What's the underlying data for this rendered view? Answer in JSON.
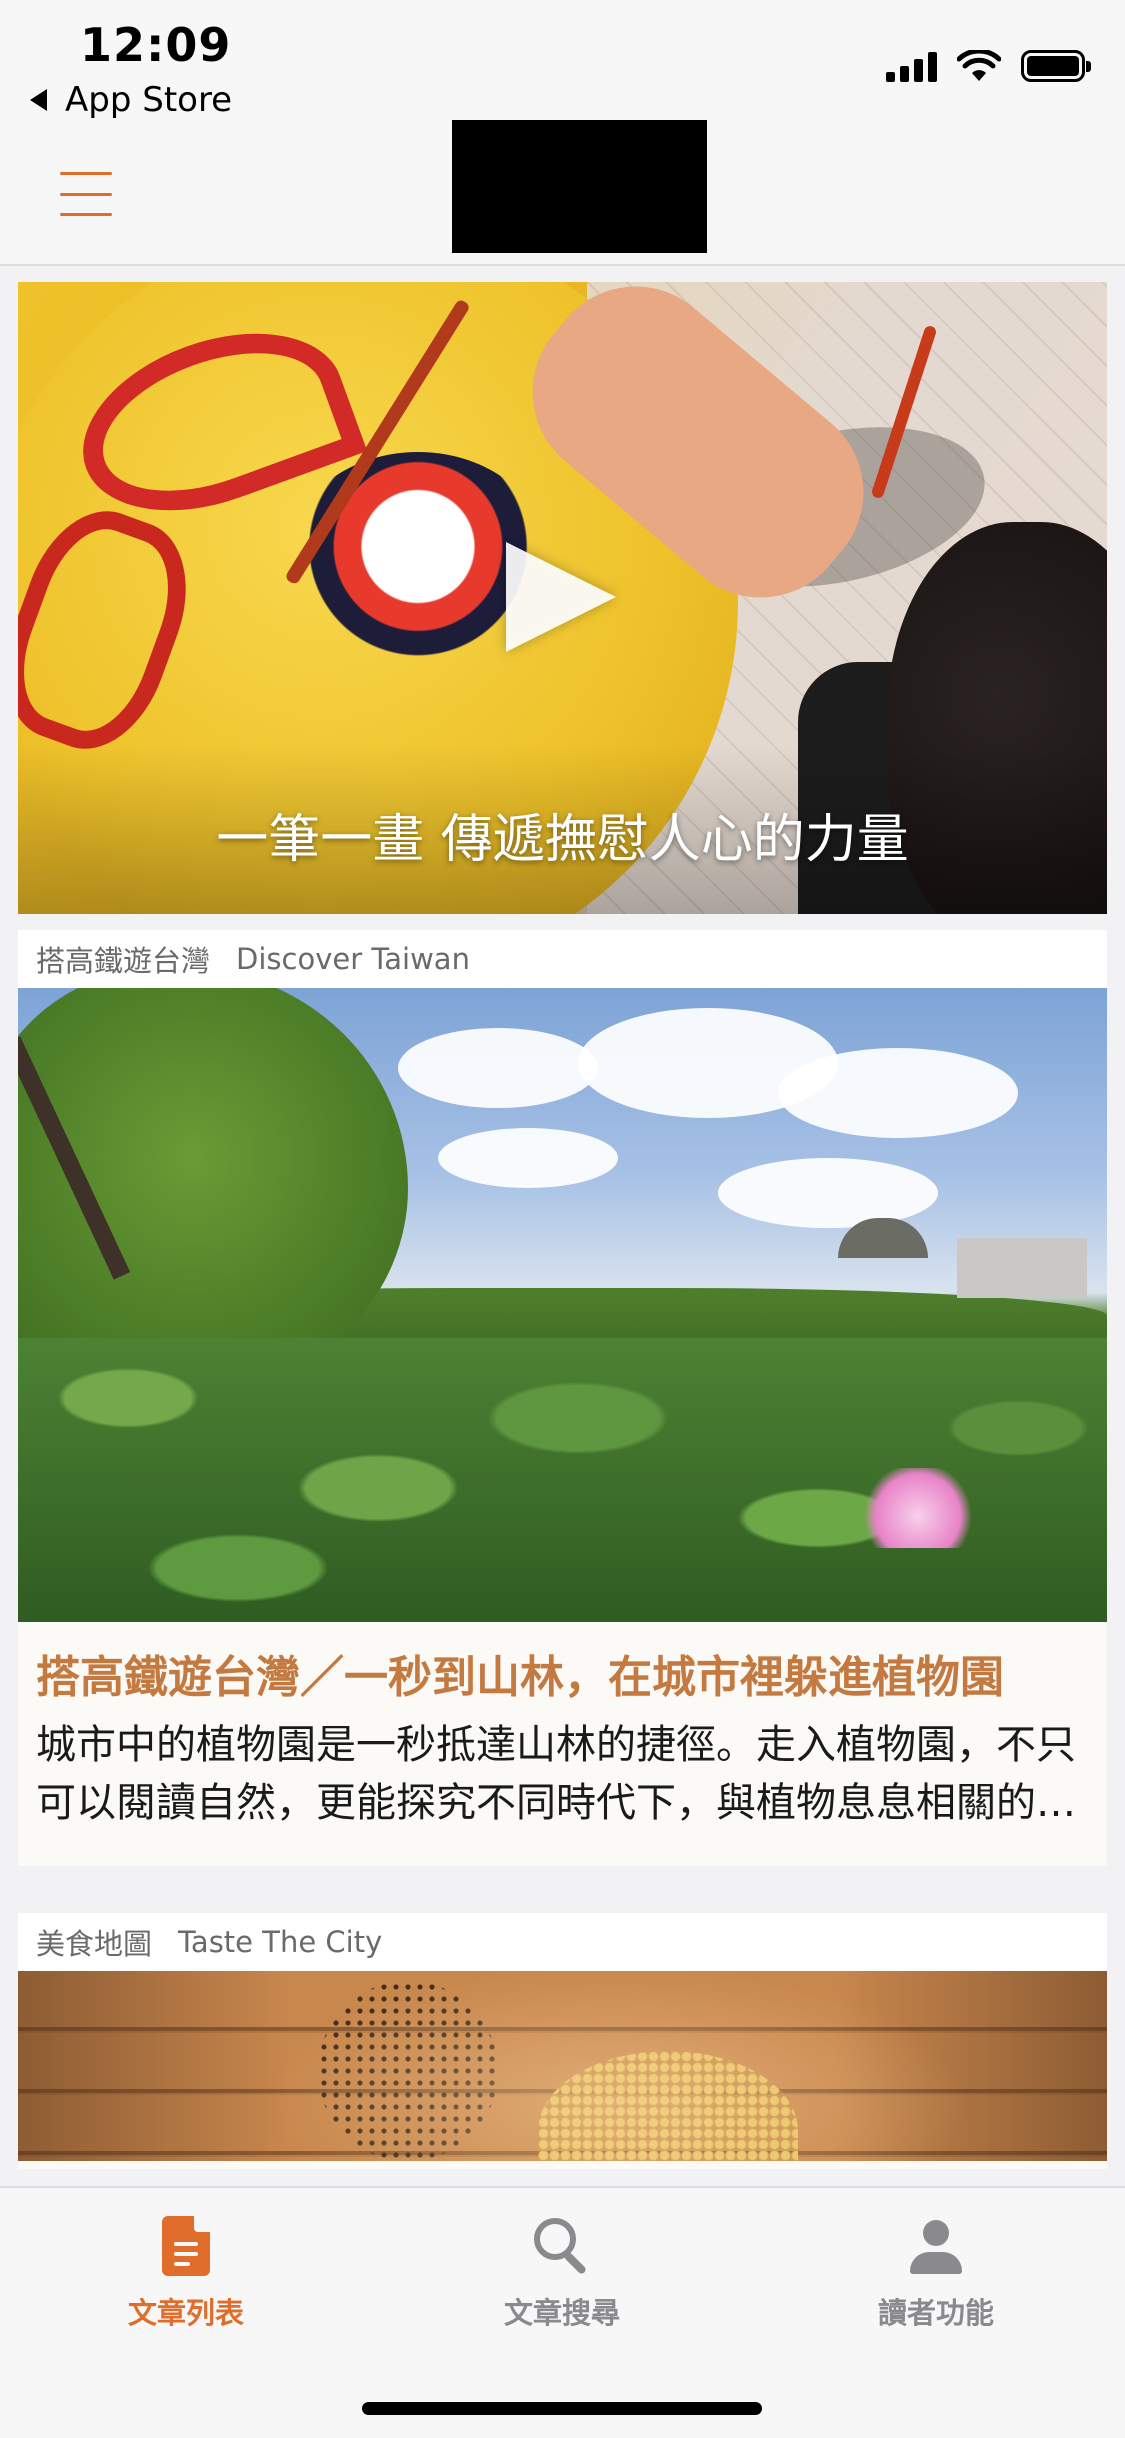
{
  "status_bar": {
    "time": "12:09",
    "back_label": "App Store"
  },
  "hero": {
    "caption": "一筆一畫 傳遞撫慰人心的力量",
    "play_icon": "play-icon"
  },
  "articles": [
    {
      "category": "搭高鐵遊台灣",
      "category_en": "Discover Taiwan",
      "title": "搭高鐵遊台灣／一秒到山林，在城市裡躲進植物園",
      "description": "城市中的植物園是一秒抵達山林的捷徑。走入植物園，不只可以閱讀自然，更能探究不同時代下，與植物息息相關的故事。"
    },
    {
      "category": "美食地圖",
      "category_en": "Taste The City"
    }
  ],
  "tab_bar": {
    "tabs": [
      {
        "label": "文章列表",
        "icon": "document-icon",
        "active": true
      },
      {
        "label": "文章搜尋",
        "icon": "search-icon",
        "active": false
      },
      {
        "label": "讀者功能",
        "icon": "person-icon",
        "active": false
      }
    ]
  },
  "colors": {
    "accent": "#e06d2c",
    "title_color": "#c3793f",
    "inactive": "#8a8a8e"
  }
}
